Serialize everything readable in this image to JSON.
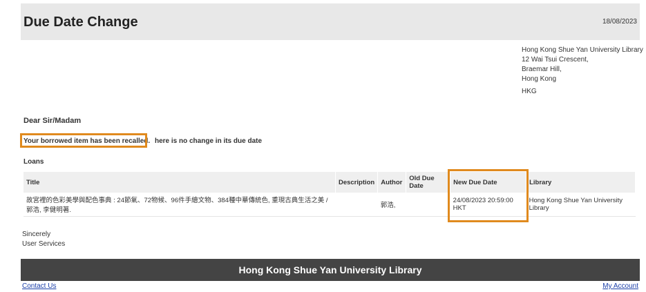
{
  "header": {
    "title": "Due Date Change",
    "date": "18/08/2023"
  },
  "address": {
    "lines": [
      "Hong Kong Shue Yan University Library",
      "12 Wai Tsui Crescent,",
      "Braemar Hill,",
      "Hong Kong"
    ],
    "country": "HKG"
  },
  "greeting": "Dear Sir/Madam",
  "message": {
    "highlighted": "Your borrowed item has been recalled.",
    "rest": "here is no change in its due date"
  },
  "loans": {
    "label": "Loans",
    "headers": [
      "Title",
      "Description",
      "Author",
      "Old Due Date",
      "New Due Date",
      "Library"
    ],
    "rows": [
      {
        "title": "故宮裡的色彩美學與配色事典 : 24節氣、72物候、96件手繪文物、384種中華傳統色, 重現古典生活之美 / 郭浩, 李健明著.",
        "description": "",
        "author": "郭浩,",
        "old_due_date": "",
        "new_due_date": "24/08/2023 20:59:00 HKT",
        "library": "Hong Kong Shue Yan University Library"
      }
    ]
  },
  "closing": {
    "line1": "Sincerely",
    "line2": "User Services"
  },
  "footer": {
    "title": "Hong Kong Shue Yan University Library"
  },
  "links": {
    "contact": "Contact Us",
    "account": "My Account"
  },
  "colors": {
    "highlight": "#e08a1e",
    "header_bg": "#e8e8e8",
    "footer_bg": "#444444",
    "link": "#1a3ea8"
  }
}
